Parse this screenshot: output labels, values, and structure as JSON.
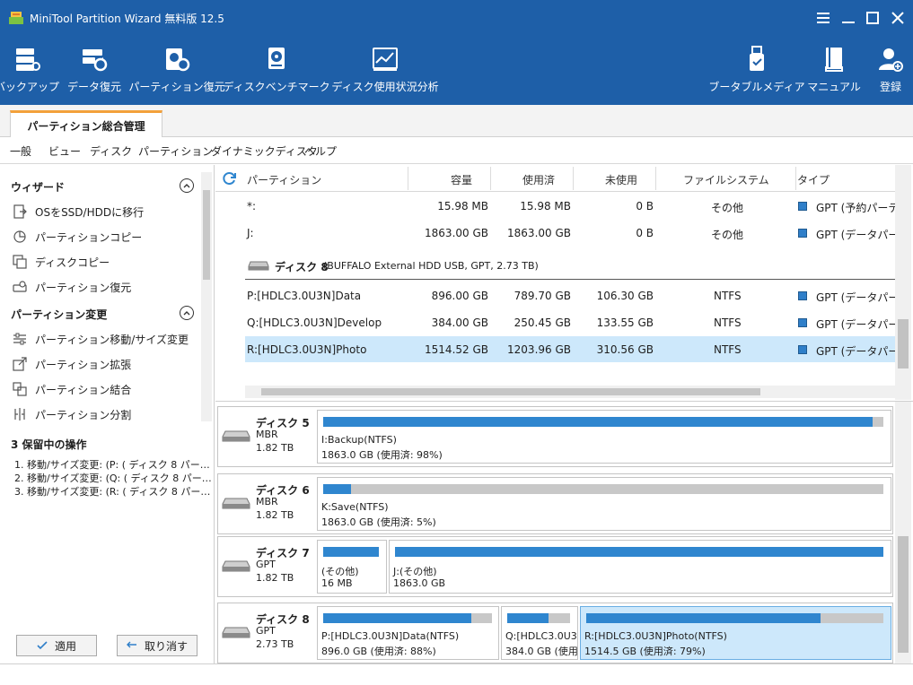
{
  "app": {
    "title": "MiniTool Partition Wizard 無料版 12.5"
  },
  "toolbar": {
    "left": [
      {
        "label": "バックアップ",
        "icon": "backup-icon"
      },
      {
        "label": "データ復元",
        "icon": "data-recovery-icon"
      },
      {
        "label": "パーティション復元",
        "icon": "partition-recovery-icon"
      },
      {
        "label": "ディスクベンチマーク",
        "icon": "disk-benchmark-icon"
      },
      {
        "label": "ディスク使用状況分析",
        "icon": "space-analyzer-icon"
      }
    ],
    "right": [
      {
        "label": "ブータブルメディア",
        "icon": "bootable-media-icon"
      },
      {
        "label": "マニュアル",
        "icon": "manual-icon"
      },
      {
        "label": "登録",
        "icon": "register-icon"
      }
    ]
  },
  "tabs": {
    "active": "パーティション総合管理"
  },
  "menu": [
    "一般",
    "ビュー",
    "ディスク",
    "パーティション",
    "ダイナミックディスク",
    "ヘルプ"
  ],
  "sidebar": {
    "wizard_title": "ウィザード",
    "wizard_items": [
      "OSをSSD/HDDに移行",
      "パーティションコピー",
      "ディスクコピー",
      "パーティション復元"
    ],
    "change_title": "パーティション変更",
    "change_items": [
      "パーティション移動/サイズ変更",
      "パーティション拡張",
      "パーティション結合",
      "パーティション分割"
    ],
    "pending_title": "3 保留中の操作",
    "pending_items": [
      "1. 移動/サイズ変更: (P: ( ディスク 8 パー…",
      "2. 移動/サイズ変更: (Q: ( ディスク 8 パー…",
      "3. 移動/サイズ変更: (R: ( ディスク 8 パー…"
    ],
    "apply_label": "適用",
    "undo_label": "取り消す"
  },
  "table": {
    "headers": [
      "パーティション",
      "容量",
      "使用済",
      "未使用",
      "ファイルシステム",
      "タイプ"
    ],
    "rows": [
      [
        "*:",
        "15.98 MB",
        "15.98 MB",
        "0 B",
        "その他",
        "GPT (予約パーティ"
      ],
      [
        "J:",
        "1863.00 GB",
        "1863.00 GB",
        "0 B",
        "その他",
        "GPT (データパーテ"
      ]
    ],
    "disk_header_name": "ディスク 8",
    "disk_header_desc": "(BUFFALO External HDD USB, GPT, 2.73 TB)",
    "rows2": [
      [
        "P:[HDLC3.0U3N]Data",
        "896.00 GB",
        "789.70 GB",
        "106.30 GB",
        "NTFS",
        "GPT (データパーテ"
      ],
      [
        "Q:[HDLC3.0U3N]Develop",
        "384.00 GB",
        "250.45 GB",
        "133.55 GB",
        "NTFS",
        "GPT (データパーテ"
      ],
      [
        "R:[HDLC3.0U3N]Photo",
        "1514.52 GB",
        "1203.96 GB",
        "310.56 GB",
        "NTFS",
        "GPT (データパーテ"
      ]
    ]
  },
  "disks": [
    {
      "name": "ディスク 5",
      "type": "MBR",
      "size": "1.82 TB",
      "parts": [
        {
          "label": "I:Backup(NTFS)",
          "detail": "1863.0 GB (使用済: 98%)",
          "used": 0.98
        }
      ]
    },
    {
      "name": "ディスク 6",
      "type": "MBR",
      "size": "1.82 TB",
      "parts": [
        {
          "label": "K:Save(NTFS)",
          "detail": "1863.0 GB (使用済: 5%)",
          "used": 0.05
        }
      ]
    },
    {
      "name": "ディスク 7",
      "type": "GPT",
      "size": "1.82 TB",
      "parts": [
        {
          "label": "(その他)",
          "detail": "16 MB",
          "used": 1.0
        },
        {
          "label": "J:(その他)",
          "detail": "1863.0 GB",
          "used": 1.0
        }
      ]
    },
    {
      "name": "ディスク 8",
      "type": "GPT",
      "size": "2.73 TB",
      "parts": [
        {
          "label": "P:[HDLC3.0U3N]Data(NTFS)",
          "detail": "896.0 GB (使用済: 88%)",
          "used": 0.88
        },
        {
          "label": "Q:[HDLC3.0U3",
          "detail": "384.0 GB (使用",
          "used": 0.65
        },
        {
          "label": "R:[HDLC3.0U3N]Photo(NTFS)",
          "detail": "1514.5 GB (使用済: 79%)",
          "used": 0.79
        }
      ]
    }
  ],
  "colors": {
    "header": "#1e5fa8",
    "accent": "#f3a13b",
    "bar": "#2f86cf",
    "selected": "#cde8fb"
  }
}
